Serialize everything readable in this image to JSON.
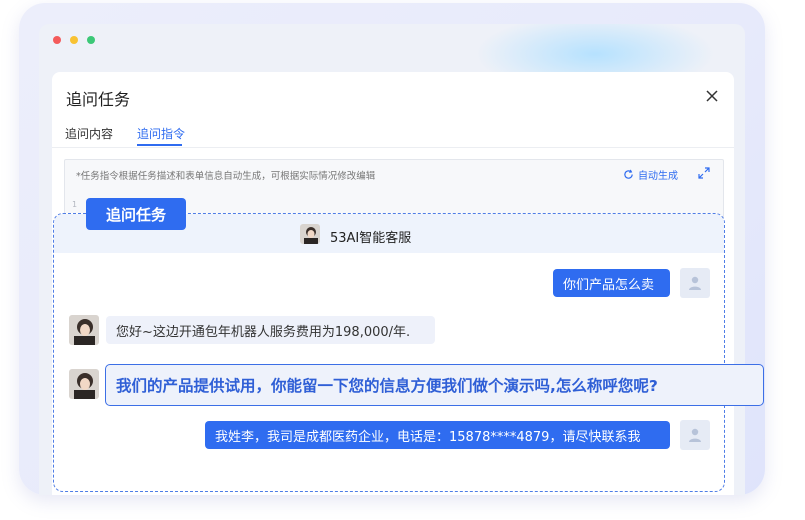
{
  "dialog": {
    "title": "追问任务",
    "tabs": [
      "追问内容",
      "追问指令"
    ],
    "active_tab": "追问指令"
  },
  "editor": {
    "hint": "*任务指令根据任务描述和表单信息自动生成，可根据实际情况修改编辑",
    "auto_generate_label": "自动生成",
    "line_number": "1"
  },
  "tag": {
    "label": "追问任务"
  },
  "chat": {
    "header_title": "53AI智能客服",
    "messages": [
      {
        "from": "user",
        "text": "你们产品怎么卖"
      },
      {
        "from": "bot",
        "text": "您好~这边开通包年机器人服务费用为198,000/年."
      },
      {
        "from": "bot",
        "text": "我们的产品提供试用，你能留一下您的信息方便我们做个演示吗,怎么称呼您呢?"
      },
      {
        "from": "user",
        "text": "我姓李，我司是成都医药企业，电话是：15878****4879，请尽快联系我"
      }
    ]
  },
  "colors": {
    "accent": "#2f6cf0",
    "highlight_text": "#2f5fd6",
    "window_dot_red": "#f45b5b",
    "window_dot_yellow": "#f8c233",
    "window_dot_green": "#3cc877"
  },
  "icons": [
    "close-icon",
    "refresh-icon",
    "expand-icon",
    "user-icon",
    "bot-avatar"
  ]
}
